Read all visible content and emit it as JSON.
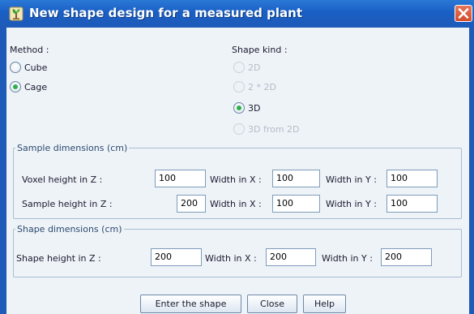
{
  "window": {
    "title": "New shape design for a measured plant",
    "icon": "plant-icon",
    "close_icon": "close-icon",
    "accent_color": "#1e5ab8",
    "close_color": "#d44a2b"
  },
  "method": {
    "label": "Method :",
    "options": [
      {
        "label": "Cube",
        "selected": false
      },
      {
        "label": "Cage",
        "selected": true
      }
    ]
  },
  "shape_kind": {
    "label": "Shape kind :",
    "options": [
      {
        "label": "2D",
        "selected": false,
        "enabled": false
      },
      {
        "label": "2 * 2D",
        "selected": false,
        "enabled": false
      },
      {
        "label": "3D",
        "selected": true,
        "enabled": true
      },
      {
        "label": "3D from 2D",
        "selected": false,
        "enabled": false
      }
    ]
  },
  "sample_dimensions": {
    "legend": "Sample dimensions (cm)",
    "rows": [
      {
        "height_label": "Voxel height in Z :",
        "height_value": "100",
        "width_x_label": "Width in X :",
        "width_x_value": "100",
        "width_y_label": "Width in Y :",
        "width_y_value": "100"
      },
      {
        "height_label": "Sample height in Z :",
        "height_value": "200",
        "width_x_label": "Width in X :",
        "width_x_value": "100",
        "width_y_label": "Width in Y :",
        "width_y_value": "100"
      }
    ]
  },
  "shape_dimensions": {
    "legend": "Shape dimensions (cm)",
    "height_label": "Shape height in Z :",
    "height_value": "200",
    "width_x_label": "Width in X :",
    "width_x_value": "200",
    "width_y_label": "Width in Y :",
    "width_y_value": "200"
  },
  "buttons": {
    "enter": "Enter the shape",
    "close": "Close",
    "help": "Help"
  }
}
